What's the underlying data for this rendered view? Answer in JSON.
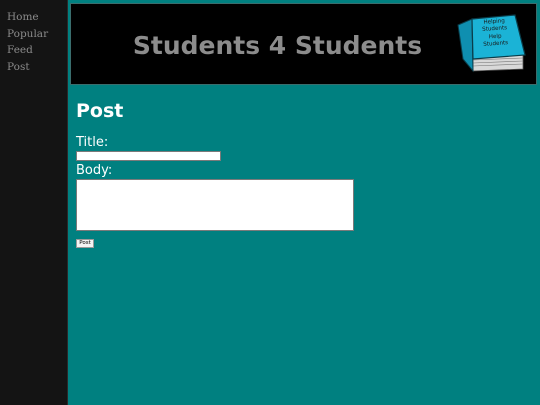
{
  "sidebar": {
    "items": [
      {
        "label": "Home"
      },
      {
        "label": "Popular"
      },
      {
        "label": "Feed"
      },
      {
        "label": "Post"
      }
    ]
  },
  "header": {
    "title": "Students 4 Students",
    "logo": {
      "icon": "book-icon",
      "text": "Helping Students Help Students",
      "cover_color": "#1bb3d6"
    }
  },
  "main": {
    "heading": "Post",
    "form": {
      "title_label": "Title:",
      "title_value": "",
      "body_label": "Body:",
      "body_value": "",
      "submit_label": "Post"
    }
  },
  "colors": {
    "background": "#008080",
    "sidebar": "#141414",
    "header": "#000000"
  }
}
